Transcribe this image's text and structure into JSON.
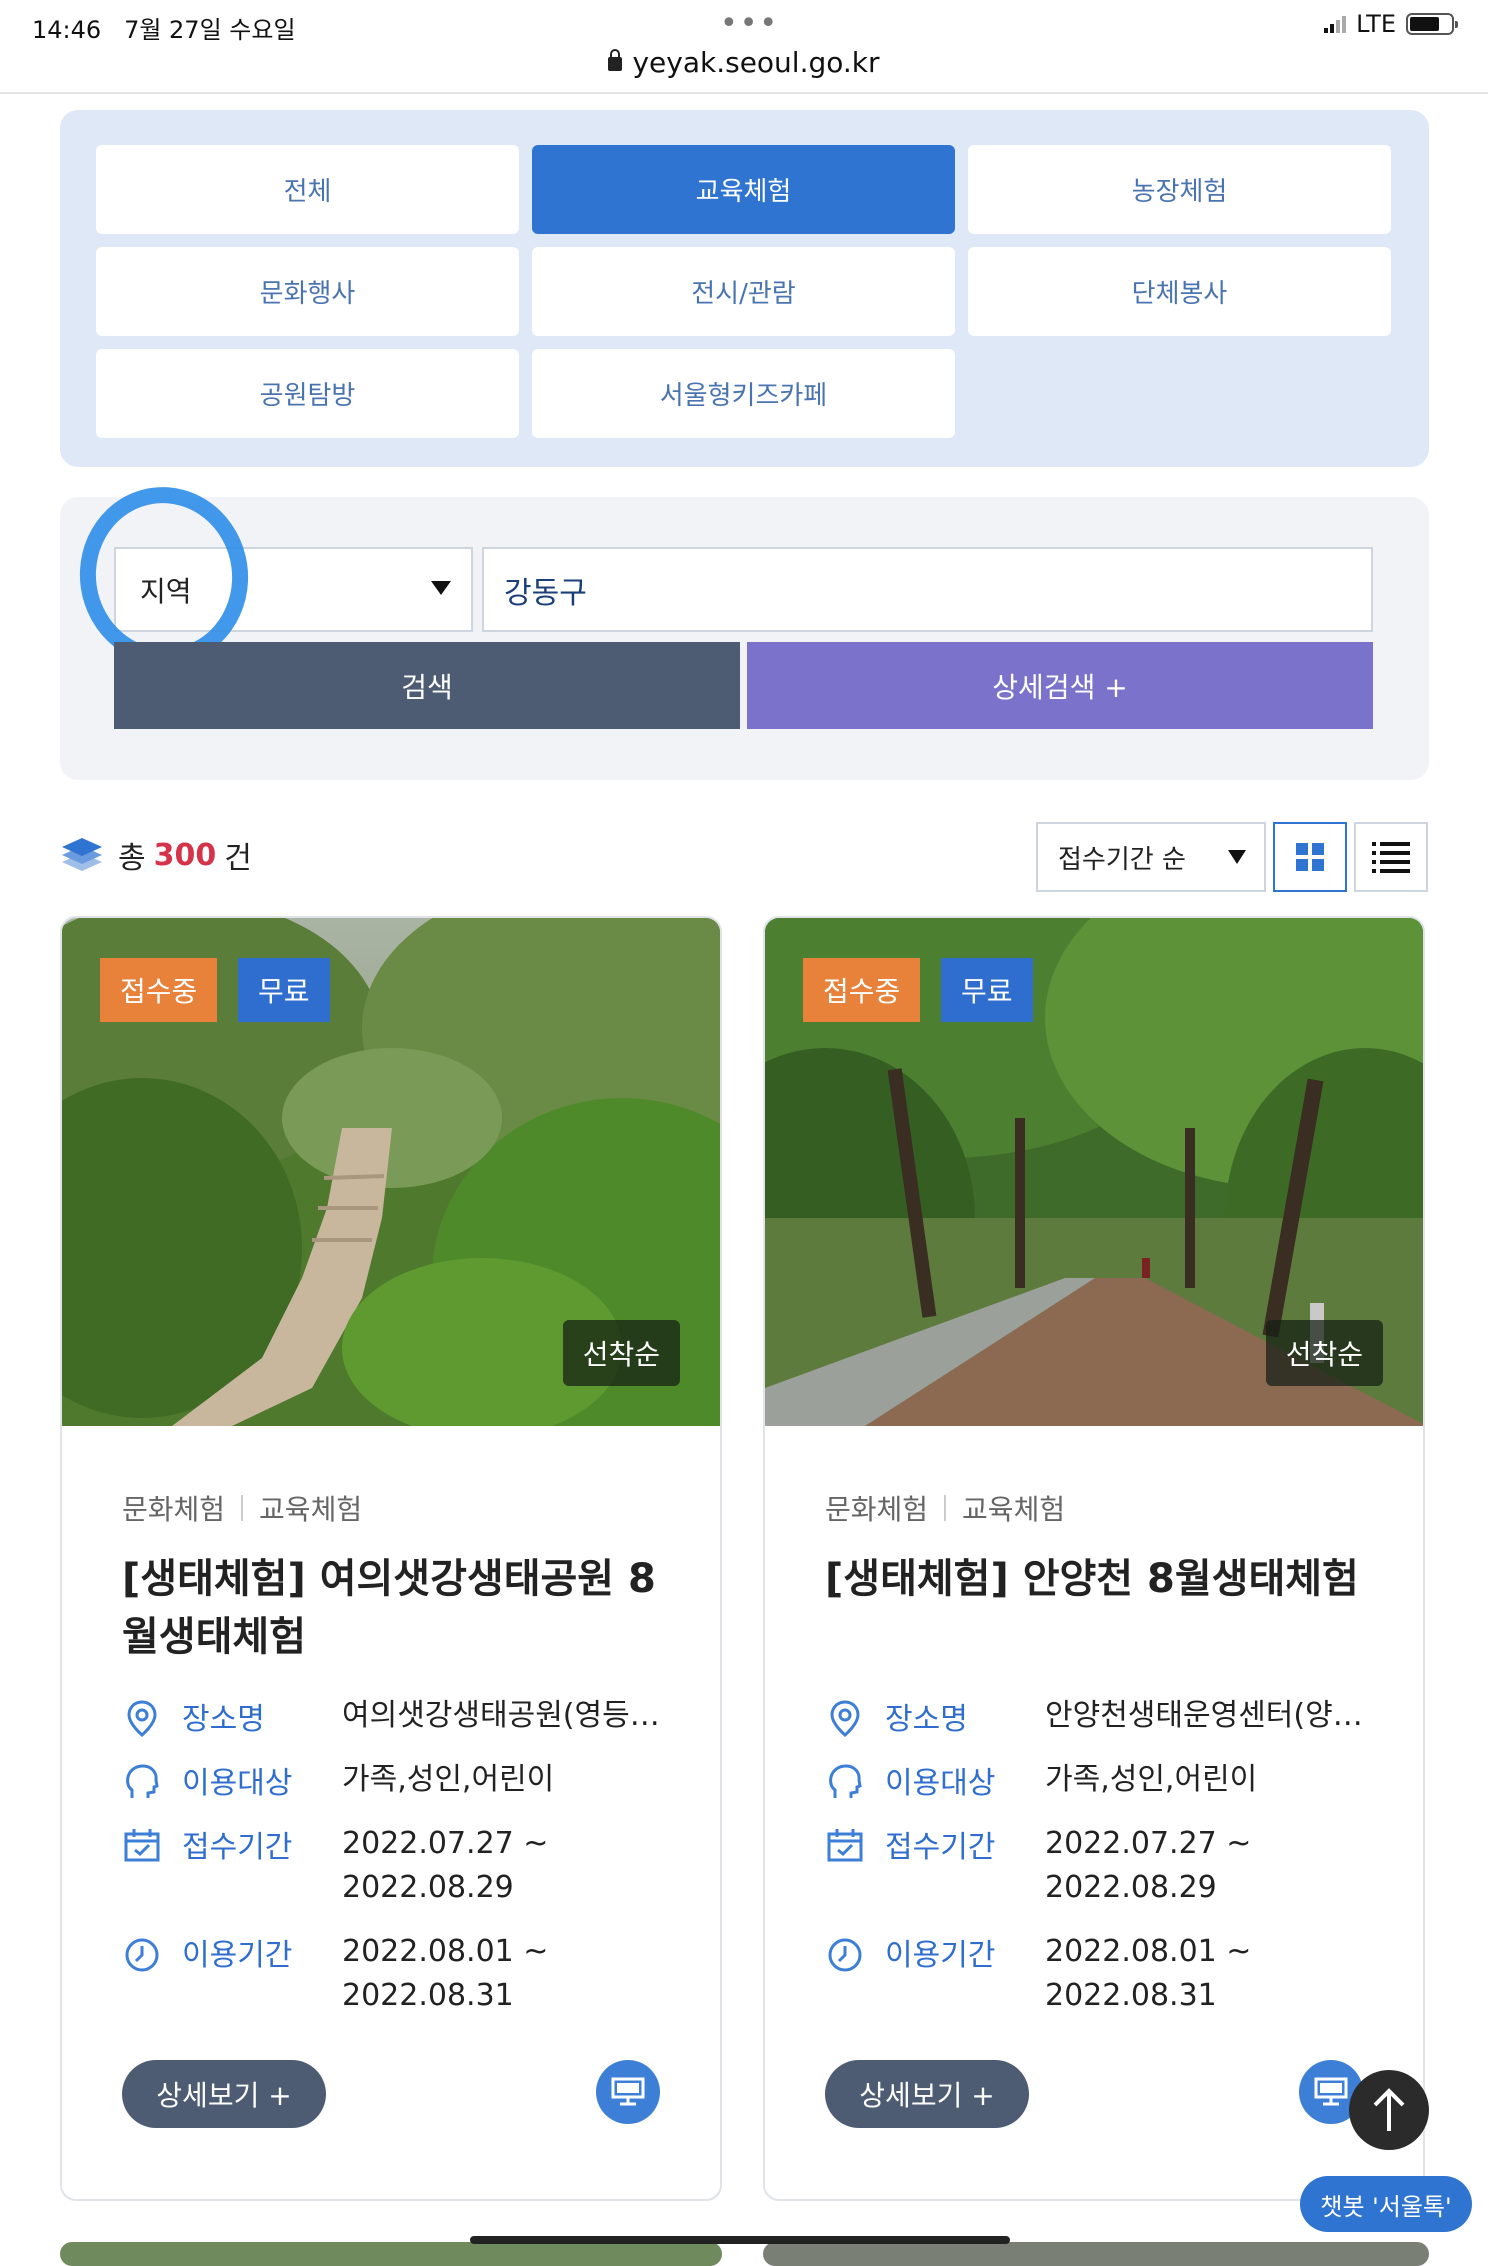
{
  "status_bar": {
    "time": "14:46",
    "date": "7월 27일 수요일",
    "dots": "•••",
    "network": "LTE",
    "url": "yeyak.seoul.go.kr"
  },
  "categories": {
    "items": [
      {
        "label": "전체",
        "active": false
      },
      {
        "label": "교육체험",
        "active": true
      },
      {
        "label": "농장체험",
        "active": false
      },
      {
        "label": "문화행사",
        "active": false
      },
      {
        "label": "전시/관람",
        "active": false
      },
      {
        "label": "단체봉사",
        "active": false
      },
      {
        "label": "공원탐방",
        "active": false
      },
      {
        "label": "서울형키즈카페",
        "active": false
      }
    ]
  },
  "search": {
    "region_label": "지역",
    "region_value": "강동구",
    "search_button": "검색",
    "advanced_button": "상세검색 +"
  },
  "results": {
    "total_prefix": "총",
    "total_count": "300",
    "total_suffix": "건",
    "sort_value": "접수기간 순"
  },
  "cards": [
    {
      "status_badge": "접수중",
      "price_badge": "무료",
      "method_badge": "선착순",
      "category_1": "문화체험",
      "category_2": "교육체험",
      "title": "[생태체험] 여의샛강생태공원 8월생태체험",
      "place_label": "장소명",
      "place_value": "여의샛강생태공원(영등포구)",
      "target_label": "이용대상",
      "target_value": "가족,성인,어린이",
      "reception_label": "접수기간",
      "reception_start": "2022.07.27 ~",
      "reception_end": "2022.08.29",
      "usage_label": "이용기간",
      "usage_start": "2022.08.01 ~",
      "usage_end": "2022.08.31",
      "detail_button": "상세보기 +"
    },
    {
      "status_badge": "접수중",
      "price_badge": "무료",
      "method_badge": "선착순",
      "category_1": "문화체험",
      "category_2": "교육체험",
      "title": "[생태체험] 안양천 8월생태체험",
      "place_label": "장소명",
      "place_value": "안양천생태운영센터(양천구)",
      "target_label": "이용대상",
      "target_value": "가족,성인,어린이",
      "reception_label": "접수기간",
      "reception_start": "2022.07.27 ~",
      "reception_end": "2022.08.29",
      "usage_label": "이용기간",
      "usage_start": "2022.08.01 ~",
      "usage_end": "2022.08.31",
      "detail_button": "상세보기 +"
    }
  ],
  "floating": {
    "chatbot_label": "챗봇 '서울톡'"
  },
  "colors": {
    "accent_blue": "#2f74d0",
    "search_button": "#4d5c73",
    "advanced_button": "#7b72cc",
    "badge_open": "#e8823a",
    "badge_free": "#2f6ecf",
    "count_red": "#d5334a"
  },
  "icons": [
    "lock-icon",
    "signal-icon",
    "battery-icon",
    "layers-icon",
    "grid-view-icon",
    "list-view-icon",
    "location-pin-icon",
    "user-head-icon",
    "calendar-icon",
    "clock-icon",
    "monitor-icon",
    "arrow-up-icon"
  ]
}
